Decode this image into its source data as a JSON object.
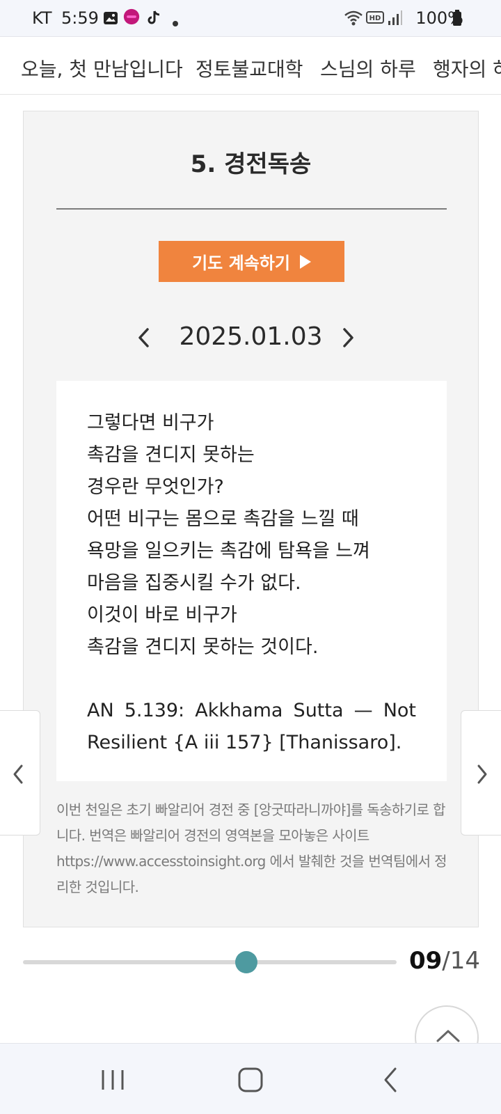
{
  "status_bar": {
    "carrier": "KT",
    "time": "5:59",
    "battery": "100%",
    "icons": [
      "image-icon",
      "app-badge-icon",
      "tiktok-icon",
      "dot-icon",
      "wifi-icon",
      "hd-voice-icon",
      "signal-icon",
      "battery-icon"
    ]
  },
  "menu": {
    "tabs": [
      {
        "label": "오늘, 첫 만남입니다"
      },
      {
        "label": "정토불교대학"
      },
      {
        "label": "스님의 하루"
      },
      {
        "label": "행자의 하"
      }
    ]
  },
  "card": {
    "title": "5. 경전독송",
    "continue_label": "기도 계속하기",
    "date": "2025.01.03",
    "verse_lines": [
      "그렇다면 비구가",
      "촉감을 견디지 못하는",
      "경우란 무엇인가?",
      "어떤 비구는 몸으로 촉감을 느낄 때",
      "욕망을 일으키는 촉감에 탐욕을 느껴",
      "마음을 집중시킬 수가 없다.",
      "이것이 바로 비구가",
      "촉감을 견디지 못하는 것이다."
    ],
    "source": "AN 5.139: Akkhama Sutta — Not Resilient {A iii 157} [Thanissaro].",
    "note": "이번 천일은 초기 빠알리어 경전 중 [앙굿따라니까야]를 독송하기로 합니다. 번역은 빠알리어 경전의 영역본을 모아놓은 사이트 https://www.accesstoinsight.org 에서 발췌한 것을 번역팀에서 정리한 것입니다."
  },
  "progress": {
    "current": "09",
    "separator": "/",
    "total": "14",
    "fraction": 0.597
  },
  "colors": {
    "accent_orange": "#f0843e",
    "slider_thumb": "#4e9aa0",
    "card_bg": "#f4f4f4"
  }
}
